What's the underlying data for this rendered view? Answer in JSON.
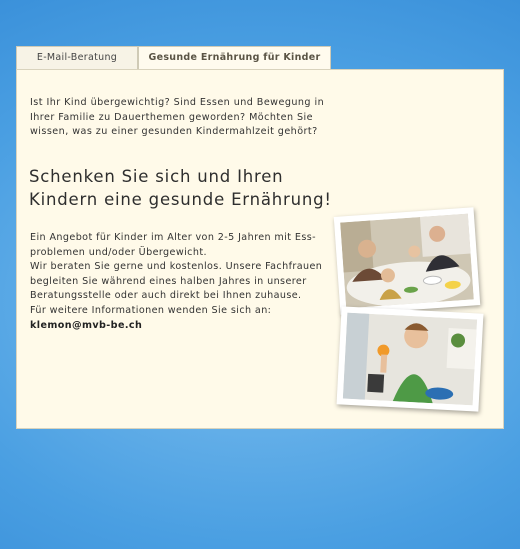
{
  "tabs": [
    {
      "label": "E-Mail-Beratung"
    },
    {
      "label": "Gesunde Ernährung für Kinder"
    }
  ],
  "intro": [
    "Ist Ihr Kind übergewichtig?  Sind Essen und Bewegung in",
    "Ihrer Familie zu Dauerthemen geworden?  Möchten Sie",
    "wissen, was zu einer gesunden Kindermahlzeit gehört?"
  ],
  "headline": [
    "Schenken Sie sich und Ihren",
    "Kindern eine gesunde Ernährung!"
  ],
  "body": [
    "Ein Angebot für Kinder im Alter von 2-5 Jahren mit Ess-",
    "problemen und/oder Übergewicht.",
    "Wir beraten  Sie gerne und kostenlos. Unsere Fachfrauen",
    "begleiten Sie während eines halben Jahres  in unserer",
    "Beratungsstelle oder auch direkt bei Ihnen zuhause.",
    "Für weitere Informationen wenden Sie sich an:"
  ],
  "email": "klemon@mvb-be.ch",
  "colors": {
    "background": "#4a9fe2",
    "panel": "#fffae9",
    "tab_border": "#cfcab6"
  }
}
